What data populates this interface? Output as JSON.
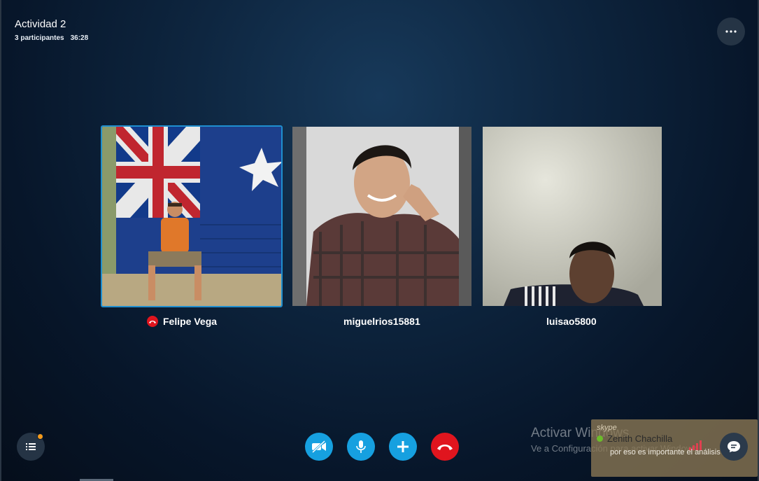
{
  "call": {
    "title": "Actividad 2",
    "participants_count": "3 participantes",
    "duration": "36:28"
  },
  "participants": [
    {
      "name": "Felipe Vega",
      "status_icon": "hangup-icon"
    },
    {
      "name": "miguelrios15881"
    },
    {
      "name": "luisao5800"
    }
  ],
  "controls": {
    "more_icon": "more-options-icon",
    "roster_icon": "participants-list-icon",
    "video_icon": "video-off-icon",
    "mic_icon": "microphone-icon",
    "add_icon": "add-icon",
    "end_icon": "end-call-icon",
    "chat_icon": "chat-icon"
  },
  "watermark": {
    "title": "Activar Windows",
    "subtitle": "Ve a Configuración para activar Windows."
  },
  "toast": {
    "brand": "skype",
    "sender": "Zenith Chachilla",
    "message": "por eso es importante el análisis"
  },
  "colors": {
    "accent_blue": "#16a0e0",
    "end_red": "#e0151e",
    "notification_dot": "#f59a1b"
  }
}
